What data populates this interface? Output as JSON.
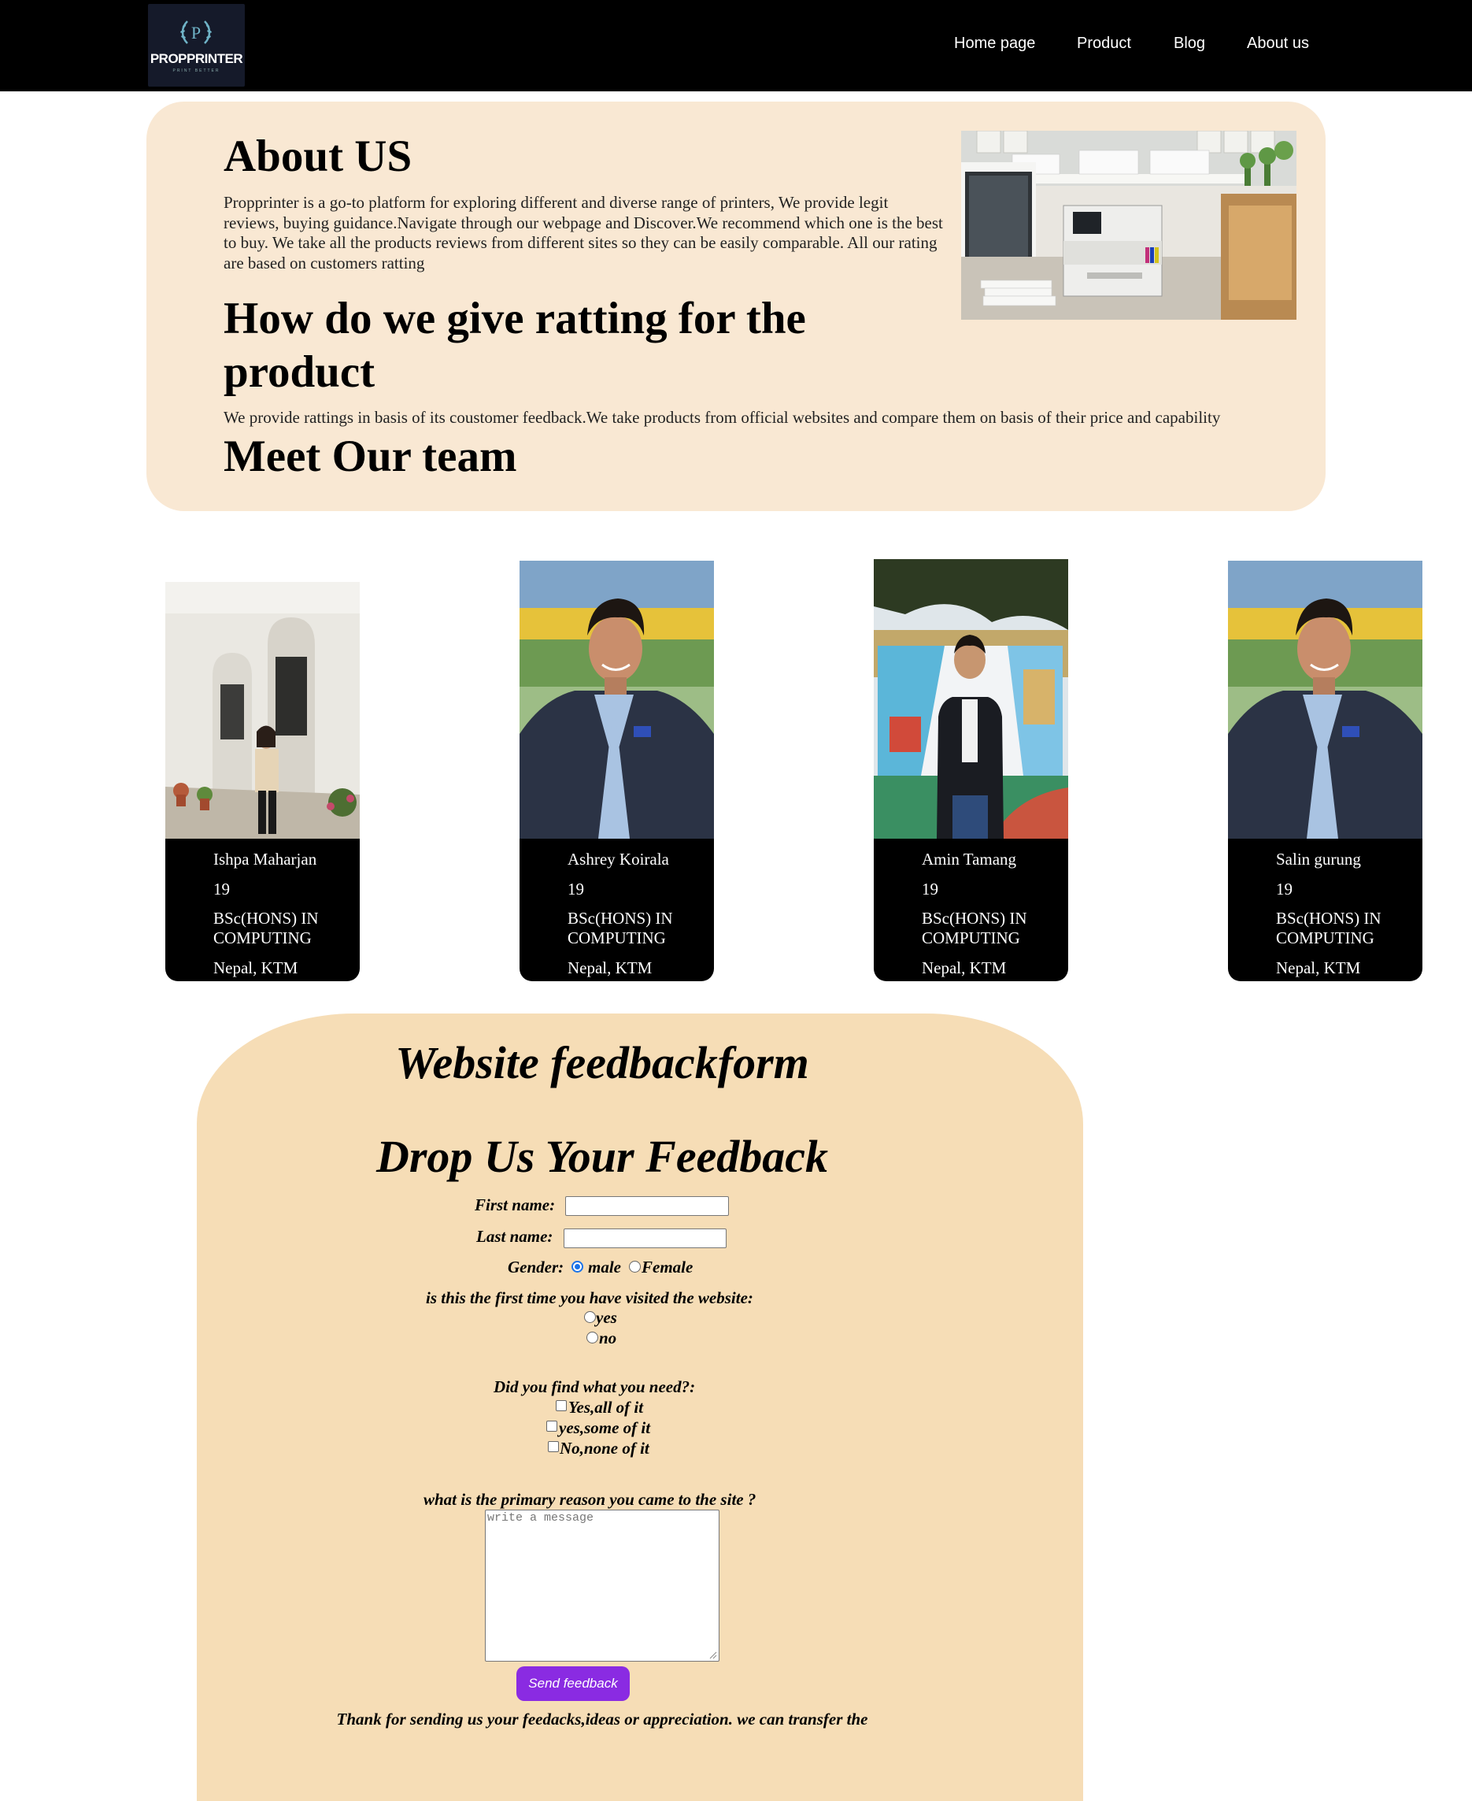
{
  "nav": {
    "logo_text": "PROPPRINTER",
    "logo_sub": "PRINT BETTER",
    "logo_letter": "P",
    "links": [
      "Home page",
      "Product",
      "Blog",
      "About us"
    ]
  },
  "about": {
    "title": "About US",
    "paragraph": "Propprinter is a go-to platform for exploring different and diverse range of printers, We provide legit reviews, buying guidance.Navigate through our webpage and Discover.We recommend which one is the best to buy. We take all the products reviews from different sites so they can be easily comparable. All our rating are based on customers ratting",
    "rating_title": "How do we give ratting for the product",
    "rating_paragraph": "We provide rattings in basis of its coustomer feedback.We take products from official websites and compare them on basis of their price and capability",
    "team_title": "Meet Our team"
  },
  "team": [
    {
      "name": "Ishpa Maharjan",
      "age": "19",
      "course": "BSc(HONS) IN COMPUTING",
      "location": "Nepal, KTM"
    },
    {
      "name": "Ashrey Koirala",
      "age": "19",
      "course": "BSc(HONS) IN COMPUTING",
      "location": "Nepal, KTM"
    },
    {
      "name": "Amin Tamang",
      "age": "19",
      "course": "BSc(HONS) IN COMPUTING",
      "location": "Nepal, KTM"
    },
    {
      "name": "Salin gurung",
      "age": "19",
      "course": "BSc(HONS) IN COMPUTING",
      "location": "Nepal, KTM"
    }
  ],
  "feedback": {
    "title": "Website feedbackform",
    "subtitle": "Drop Us Your Feedback",
    "first_name_label": "First name:",
    "last_name_label": "Last name:",
    "gender_label": "Gender:",
    "gender_options": [
      "male",
      "Female"
    ],
    "gender_selected": "male",
    "first_visit_label": "is this the first time you have visited the website:",
    "first_visit_options": [
      "yes",
      "no"
    ],
    "find_label": "Did you find what you need?:",
    "find_options": [
      "Yes,all of it",
      "yes,some of it",
      "No,none of it"
    ],
    "reason_label": "what is the primary reason you came to the site ?",
    "reason_placeholder": "write a message",
    "send_label": "Send feedback",
    "thanks_text": "Thank for sending us your feedacks,ideas or appreciation. we can transfer the"
  },
  "colors": {
    "nav_bg": "#000000",
    "about_bg": "#f9e8d3",
    "feedback_bg": "#f6ddb6",
    "send_button": "#8a2be2",
    "radio_accent": "#1a73e8"
  }
}
